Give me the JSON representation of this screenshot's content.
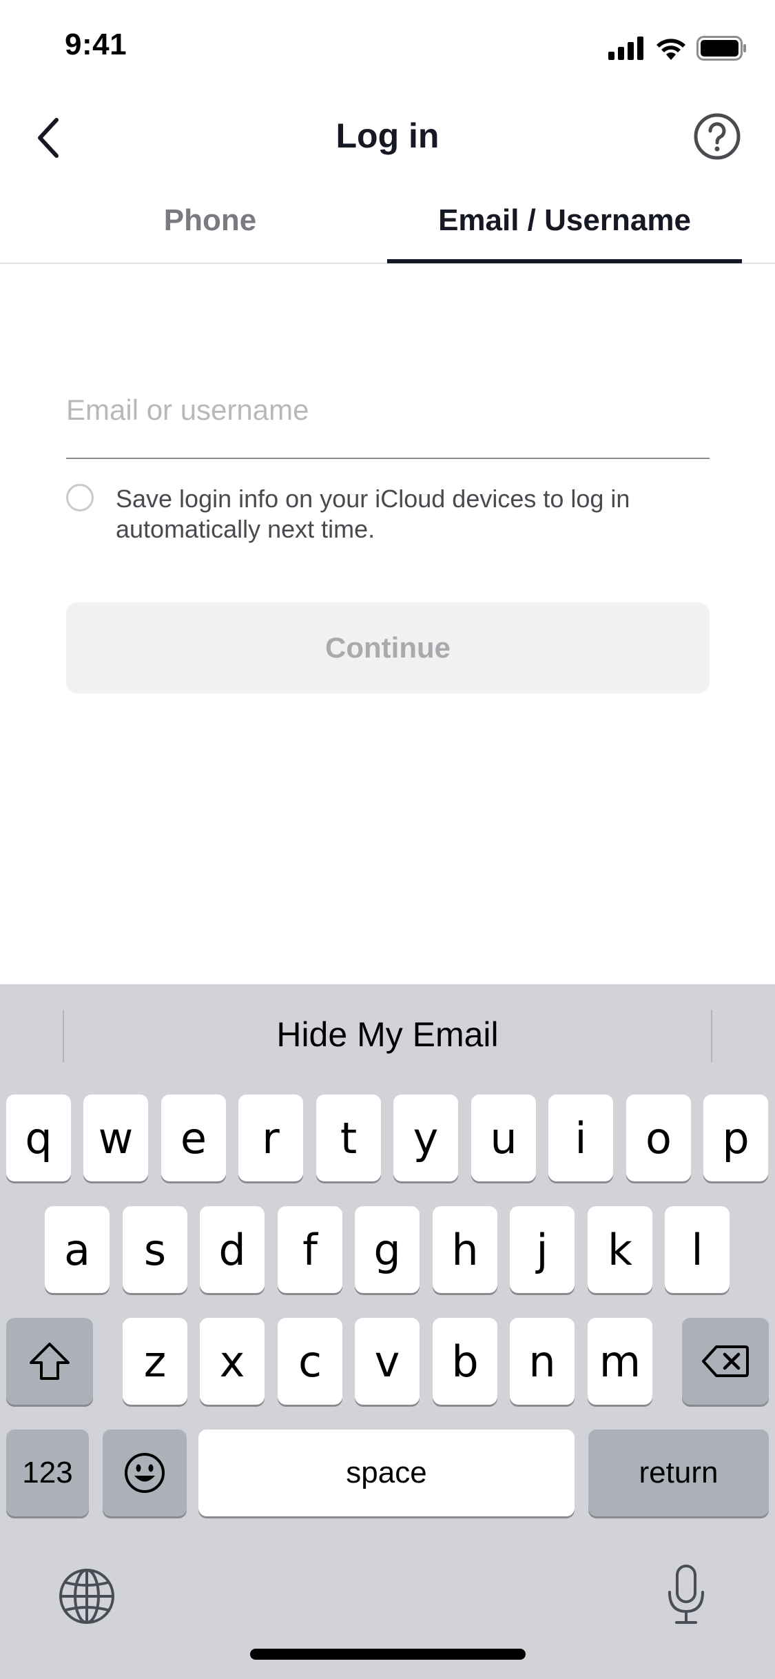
{
  "status_bar": {
    "time": "9:41"
  },
  "header": {
    "title": "Log in"
  },
  "tabs": [
    {
      "label": "Phone",
      "active": false
    },
    {
      "label": "Email / Username",
      "active": true
    }
  ],
  "email_field": {
    "value": "",
    "placeholder": "Email or username"
  },
  "save_login": {
    "text": "Save login info on your iCloud devices to log in automatically next time.",
    "checked": false
  },
  "continue_button": {
    "label": "Continue",
    "enabled": false
  },
  "keyboard": {
    "suggestion": "Hide My Email",
    "row1": [
      "q",
      "w",
      "e",
      "r",
      "t",
      "y",
      "u",
      "i",
      "o",
      "p"
    ],
    "row2": [
      "a",
      "s",
      "d",
      "f",
      "g",
      "h",
      "j",
      "k",
      "l"
    ],
    "row3": [
      "z",
      "x",
      "c",
      "v",
      "b",
      "n",
      "m"
    ],
    "numbers_label": "123",
    "space_label": "space",
    "return_label": "return"
  },
  "icons": {
    "back": "chevron-left-icon",
    "help": "question-circle-icon",
    "shift": "shift-icon",
    "backspace": "delete-backward-icon",
    "emoji": "smiley-icon",
    "globe": "globe-icon",
    "mic": "microphone-icon"
  }
}
